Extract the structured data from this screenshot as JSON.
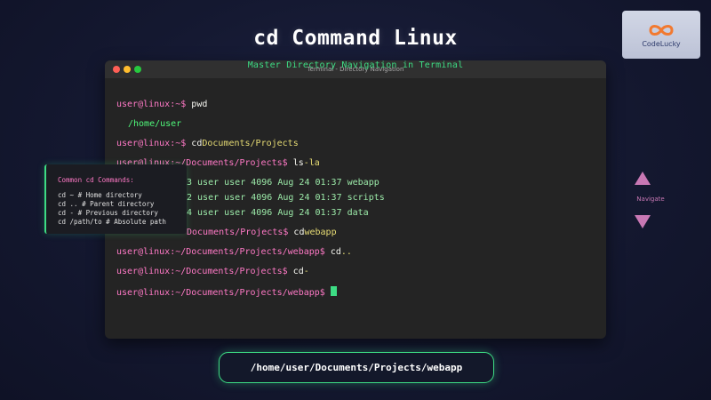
{
  "header": {
    "title": "cd Command Linux",
    "subtitle": "Master Directory Navigation in Terminal"
  },
  "logo": {
    "text": "CodeLucky"
  },
  "terminal": {
    "window_title": "Terminal - Directory Navigation",
    "lines": [
      {
        "prompt": "user@linux:~$ ",
        "cmd": "pwd",
        "arg": ""
      },
      {
        "output": "/home/user"
      },
      {
        "prompt": "user@linux:~$ ",
        "cmd": "cd",
        "arg": "Documents/Projects"
      },
      {
        "prompt": "user@linux:~/Documents/Projects$ ",
        "cmd": "ls",
        "arg": "-la"
      },
      {
        "output": "3 user user 4096 Aug 24 01:37 webapp"
      },
      {
        "output": "2 user user 4096 Aug 24 01:37 scripts"
      },
      {
        "output": "4 user user 4096 Aug 24 01:37 data"
      },
      {
        "prompt": "Documents/Projects$ ",
        "cmd": "cd",
        "arg": "webapp"
      },
      {
        "prompt": "user@linux:~/Documents/Projects/webapp$ ",
        "cmd": "cd",
        "arg": ".."
      },
      {
        "prompt": "user@linux:~/Documents/Projects$ ",
        "cmd": "cd",
        "arg": "-"
      },
      {
        "prompt": "user@linux:~/Documents/Projects/webapp$ ",
        "cmd": "",
        "arg": ""
      }
    ]
  },
  "tooltip": {
    "title": "Common cd Commands:",
    "items": [
      "cd ~ # Home directory",
      "cd .. # Parent directory",
      "cd - # Previous directory",
      "cd /path/to # Absolute path"
    ]
  },
  "nav": {
    "label": "Navigate"
  },
  "current_path": "/home/user/Documents/Projects/webapp",
  "colors": {
    "accent": "#3ddc84",
    "prompt": "#ff79c6",
    "nav": "#c878b4"
  }
}
